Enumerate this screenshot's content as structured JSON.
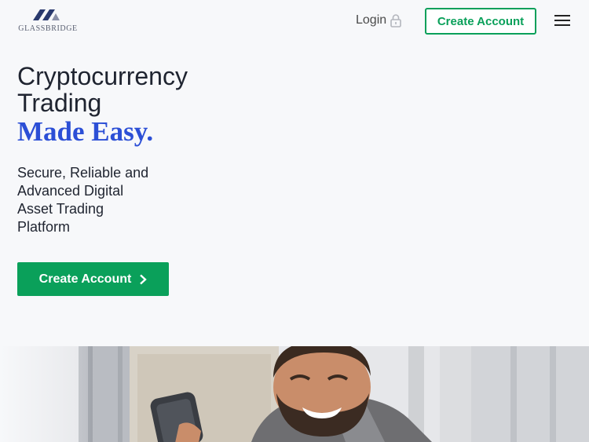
{
  "brand": {
    "name": "GLASSBRIDGE"
  },
  "header": {
    "login_label": "Login",
    "create_account_label": "Create Account"
  },
  "hero": {
    "title": "Cryptocurrency Trading",
    "accent": "Made Easy.",
    "subtitle": "Secure, Reliable and Advanced Digital Asset Trading Platform",
    "cta_label": "Create Account"
  },
  "colors": {
    "brand_green": "#0aa05a",
    "accent_blue": "#2c4fd6",
    "text_dark": "#1f2430",
    "background": "#f7f8fa"
  },
  "icons": [
    "lock-icon",
    "hamburger-menu-icon",
    "chevron-right-icon",
    "logo-mark-icon"
  ]
}
